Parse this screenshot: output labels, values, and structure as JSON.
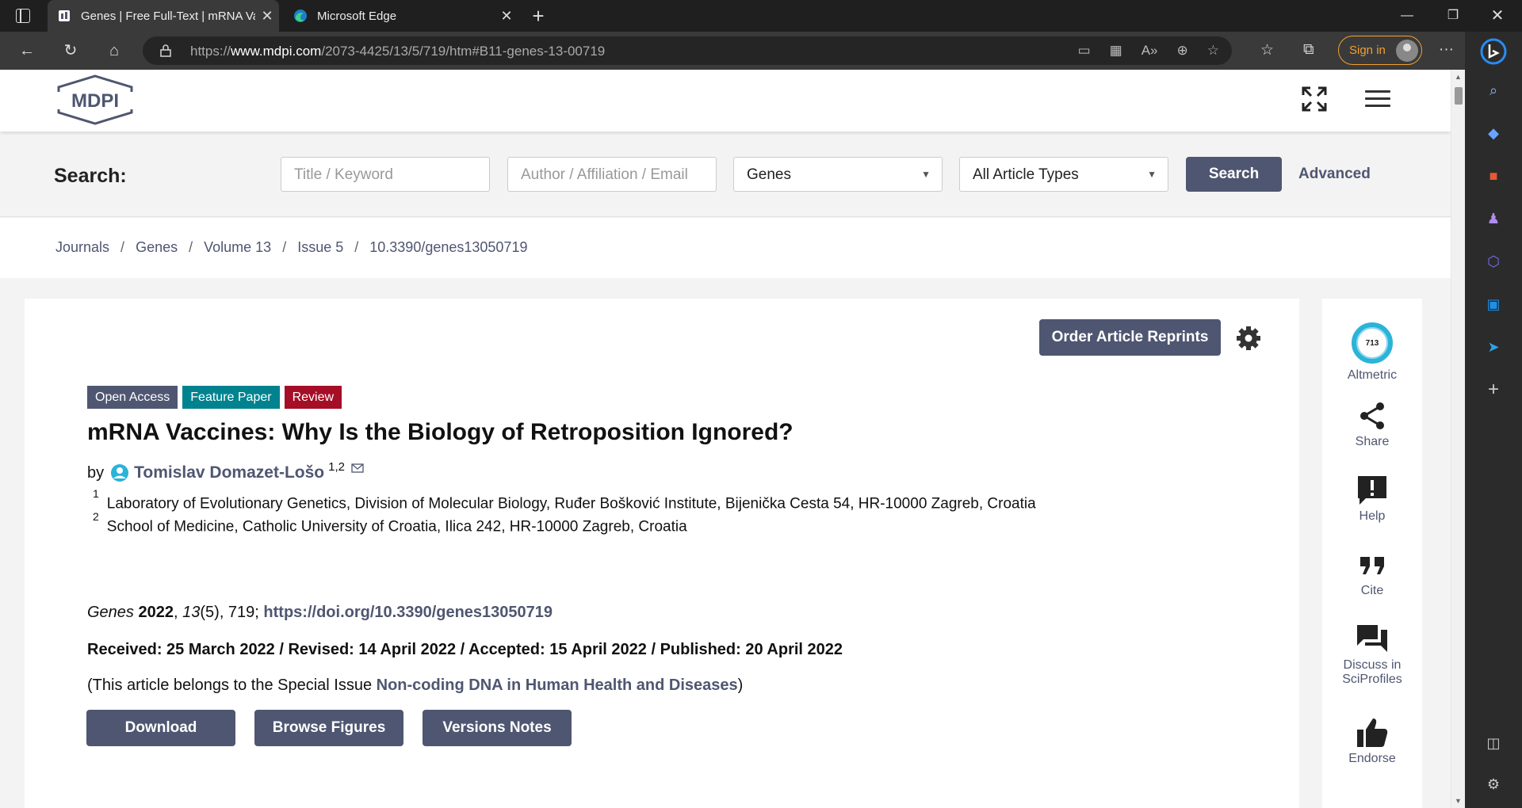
{
  "browser": {
    "tabs": [
      {
        "label": "Genes | Free Full-Text | mRNA Va",
        "active": true
      },
      {
        "label": "Microsoft Edge",
        "active": false
      }
    ],
    "url_prefix": "https://",
    "url_domain": "www.mdpi.com",
    "url_path": "/2073-4425/13/5/719/htm#B11-genes-13-00719",
    "signin_label": "Sign in",
    "accent_color": "#f0a030"
  },
  "site": {
    "logo_text": "MDPI",
    "brand_color": "#4f5671"
  },
  "search": {
    "label": "Search:",
    "keyword_placeholder": "Title / Keyword",
    "author_placeholder": "Author / Affiliation / Email",
    "journal_value": "Genes",
    "article_type_value": "All Article Types",
    "search_button": "Search",
    "advanced_link": "Advanced"
  },
  "breadcrumb": [
    "Journals",
    "Genes",
    "Volume 13",
    "Issue 5",
    "10.3390/genes13050719"
  ],
  "article": {
    "reprints_button": "Order Article Reprints",
    "badges": [
      {
        "label": "Open Access",
        "color": "#4f5671"
      },
      {
        "label": "Feature Paper",
        "color": "#00838f"
      },
      {
        "label": "Review",
        "color": "#a50e26"
      }
    ],
    "title": "mRNA Vaccines: Why Is the Biology of Retroposition Ignored?",
    "by": "by",
    "author": "Tomislav Domazet-Lošo",
    "author_sup": "1,2",
    "affiliations": [
      {
        "num": "1",
        "text": "Laboratory of Evolutionary Genetics, Division of Molecular Biology, Ruđer Bošković Institute, Bijenička Cesta 54, HR-10000 Zagreb, Croatia"
      },
      {
        "num": "2",
        "text": "School of Medicine, Catholic University of Croatia, Ilica 242, HR-10000 Zagreb, Croatia"
      }
    ],
    "citation": {
      "journal": "Genes",
      "year": "2022",
      "sep1": ", ",
      "volume": "13",
      "rest": "(5), 719; ",
      "doi": "https://doi.org/10.3390/genes13050719"
    },
    "dates": "Received: 25 March 2022 / Revised: 14 April 2022 / Accepted: 15 April 2022 / Published: 20 April 2022",
    "special_prefix": "(This article belongs to the Special Issue ",
    "special_link": "Non-coding DNA in Human Health and Diseases",
    "special_suffix": ")",
    "buttons": [
      "Download",
      "Browse Figures",
      "Versions Notes"
    ]
  },
  "right_panel": {
    "altmetric_score": "713",
    "items": [
      "Altmetric",
      "Share",
      "Help",
      "Cite",
      "Discuss in SciProfiles",
      "Endorse"
    ]
  }
}
